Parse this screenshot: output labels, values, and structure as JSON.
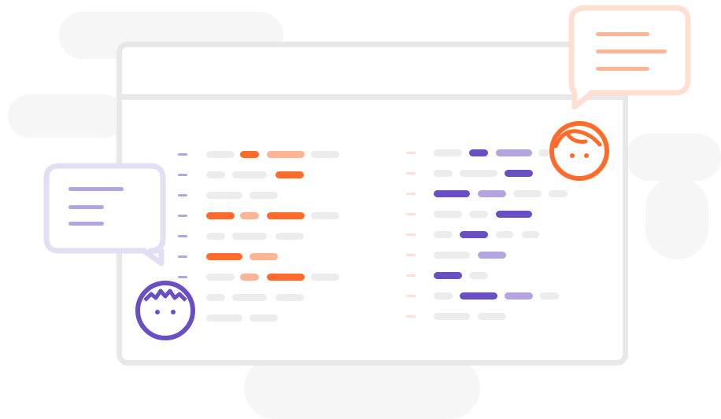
{
  "scene": "chat-illustration",
  "colors": {
    "background": "#ffffff",
    "cloud": "#f6f6f6",
    "window_border": "#e8e8e8",
    "placeholder": "#ececec",
    "orange": "#ff6b2b",
    "orange_light": "#ffb594",
    "orange_faint": "#fde0d2",
    "purple": "#6a4fc4",
    "purple_light": "#b4a4e0",
    "purple_faint": "#e4def5"
  },
  "icons": {
    "left_avatar": "person-icon",
    "right_avatar": "person-icon",
    "left_bubble": "chat-bubble-icon",
    "right_bubble": "chat-bubble-icon"
  }
}
